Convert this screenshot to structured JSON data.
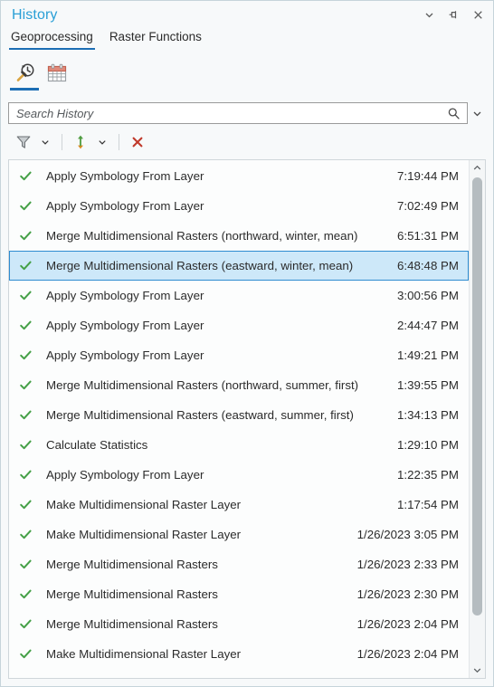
{
  "window": {
    "title": "History",
    "controls": [
      {
        "name": "menu-chevron",
        "icon": "chevron-down-icon",
        "label": "Menu"
      },
      {
        "name": "pin",
        "icon": "pin-icon",
        "label": "Auto Hide"
      },
      {
        "name": "close",
        "icon": "close-icon",
        "label": "Close"
      }
    ]
  },
  "tabs": [
    {
      "label": "Geoprocessing",
      "active": true
    },
    {
      "label": "Raster Functions",
      "active": false
    }
  ],
  "view_buttons": [
    {
      "label": "Tool History",
      "icon": "hammer-clock-icon",
      "selected": true
    },
    {
      "label": "Date View",
      "icon": "calendar-icon",
      "selected": false
    }
  ],
  "search": {
    "placeholder": "Search History",
    "value": "",
    "icon": "search-icon",
    "caret": "chevron-down-icon"
  },
  "toolbar": [
    {
      "name": "filter-button",
      "icon": "filter-icon",
      "label": "Filter"
    },
    {
      "name": "filter-menu-button",
      "icon": "chevron-down-icon",
      "label": "Filter options"
    },
    {
      "name": "sort-button",
      "icon": "sort-arrows-icon",
      "label": "Sort"
    },
    {
      "name": "sort-menu-button",
      "icon": "chevron-down-icon",
      "label": "Sort options"
    },
    {
      "name": "clear-button",
      "icon": "close-x-icon",
      "label": "Clear"
    }
  ],
  "colors": {
    "title": "#2a9fd6",
    "accent": "#1c6eb4",
    "success": "#45a047",
    "clear": "#c0392b",
    "selection_fill": "#cde8f9",
    "selection_border": "#2e8cd0"
  },
  "history": {
    "status_icon": "green-check-icon",
    "items": [
      {
        "tool": "Apply Symbology From Layer",
        "params": "",
        "time": "7:19:44 PM",
        "selected": false
      },
      {
        "tool": "Apply Symbology From Layer",
        "params": "",
        "time": "7:02:49 PM",
        "selected": false
      },
      {
        "tool": "Merge Multidimensional Rasters",
        "params": "(northward, winter, mean)",
        "time": "6:51:31 PM",
        "selected": false
      },
      {
        "tool": "Merge Multidimensional Rasters",
        "params": "(eastward, winter, mean)",
        "time": "6:48:48 PM",
        "selected": true
      },
      {
        "tool": "Apply Symbology From Layer",
        "params": "",
        "time": "3:00:56 PM",
        "selected": false
      },
      {
        "tool": "Apply Symbology From Layer",
        "params": "",
        "time": "2:44:47 PM",
        "selected": false
      },
      {
        "tool": "Apply Symbology From Layer",
        "params": "",
        "time": "1:49:21 PM",
        "selected": false
      },
      {
        "tool": "Merge Multidimensional Rasters",
        "params": "(northward, summer, first)",
        "time": "1:39:55 PM",
        "selected": false
      },
      {
        "tool": "Merge Multidimensional Rasters",
        "params": "(eastward, summer, first)",
        "time": "1:34:13 PM",
        "selected": false
      },
      {
        "tool": "Calculate Statistics",
        "params": "",
        "time": "1:29:10 PM",
        "selected": false
      },
      {
        "tool": "Apply Symbology From Layer",
        "params": "",
        "time": "1:22:35 PM",
        "selected": false
      },
      {
        "tool": "Make Multidimensional Raster Layer",
        "params": "",
        "time": "1:17:54 PM",
        "selected": false
      },
      {
        "tool": "Make Multidimensional Raster Layer",
        "params": "",
        "time": "1/26/2023 3:05 PM",
        "selected": false
      },
      {
        "tool": "Merge Multidimensional Rasters",
        "params": "",
        "time": "1/26/2023 2:33 PM",
        "selected": false
      },
      {
        "tool": "Merge Multidimensional Rasters",
        "params": "",
        "time": "1/26/2023 2:30 PM",
        "selected": false
      },
      {
        "tool": "Merge Multidimensional Rasters",
        "params": "",
        "time": "1/26/2023 2:04 PM",
        "selected": false
      },
      {
        "tool": "Make Multidimensional Raster Layer",
        "params": "",
        "time": "1/26/2023 2:04 PM",
        "selected": false
      }
    ]
  },
  "scrollbar": {
    "up": "chevron-up-icon",
    "down": "chevron-down-icon"
  }
}
